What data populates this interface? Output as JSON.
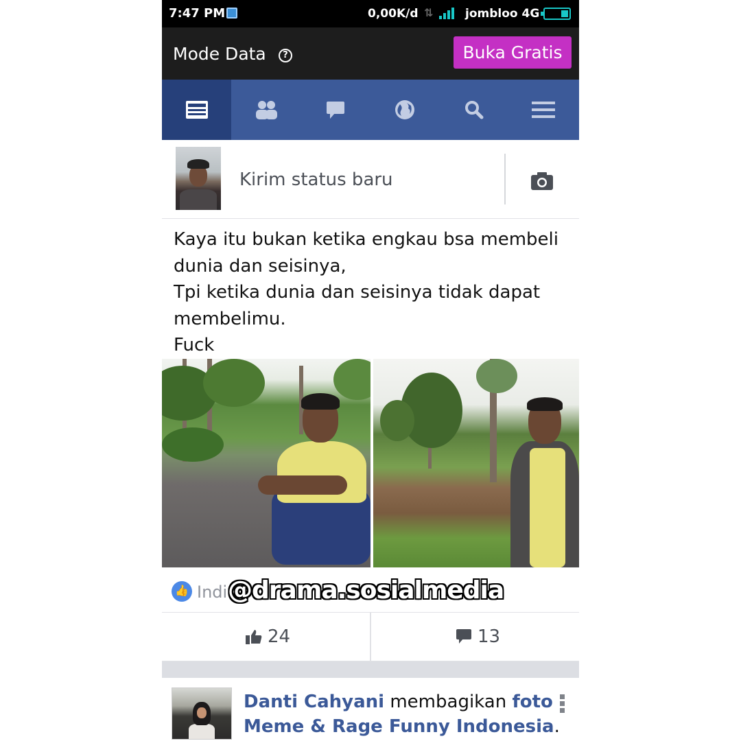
{
  "statusbar": {
    "time": "7:47 PM",
    "speed": "0,00K/d",
    "carrier": "jombloo 4G",
    "accent_color": "#19c7c7"
  },
  "modebar": {
    "title": "Mode Data",
    "help_icon": "question-circle-icon",
    "button_label": "Buka Gratis",
    "button_color": "#c430c4"
  },
  "navbar": {
    "color": "#3c5a99",
    "active_color": "#26407a",
    "tabs": [
      {
        "icon": "news-feed-icon",
        "active": true
      },
      {
        "icon": "friends-icon",
        "active": false
      },
      {
        "icon": "messages-icon",
        "active": false
      },
      {
        "icon": "globe-notifications-icon",
        "active": false
      },
      {
        "icon": "search-icon",
        "active": false
      },
      {
        "icon": "menu-icon",
        "active": false
      }
    ]
  },
  "composer": {
    "placeholder": "Kirim status baru",
    "camera_icon": "camera-icon"
  },
  "post": {
    "lines": [
      "Kaya itu bukan ketika engkau bsa membeli",
      "dunia dan seisinya,",
      "Tpi ketika dunia dan seisinya tidak dapat",
      "membelimu.",
      "Fuck"
    ],
    "reaction_names": "Indi",
    "watermark": "@drama.sosialmedia",
    "like_count": "24",
    "comment_count": "13"
  },
  "story": {
    "author": "Danti Cahyani",
    "verb": " membagikan ",
    "object": "foto",
    "page": "Meme & Rage Funny Indonesia",
    "suffix": "."
  }
}
